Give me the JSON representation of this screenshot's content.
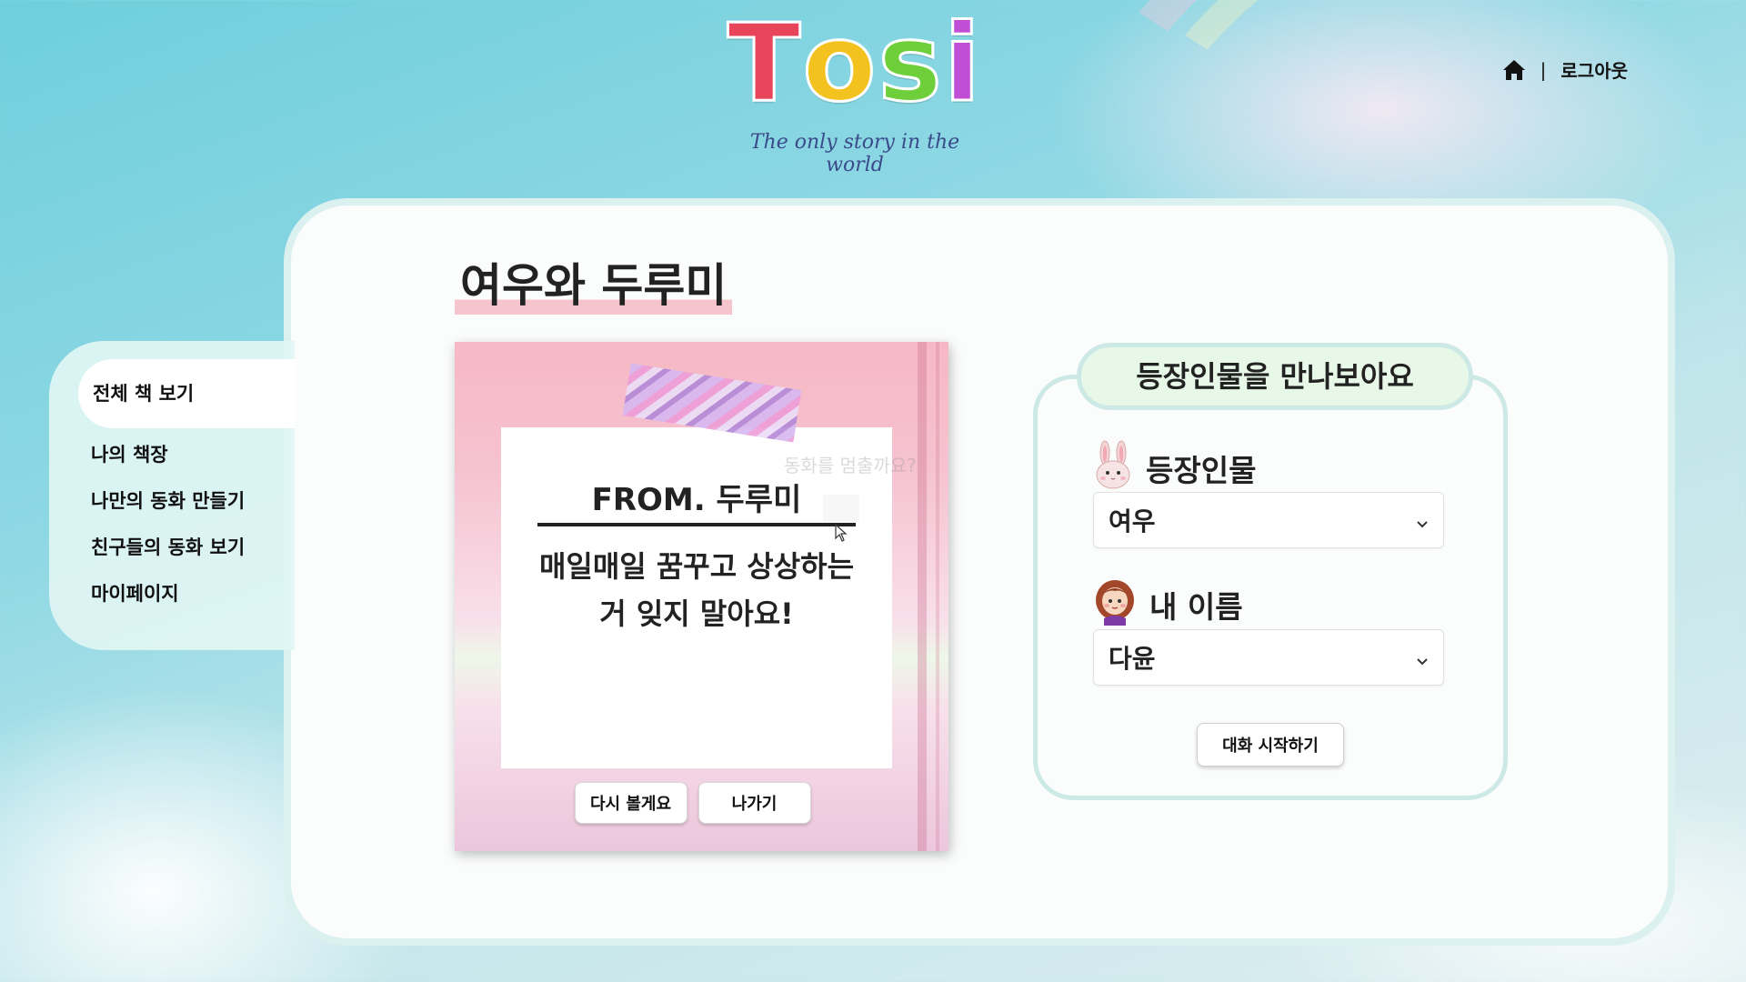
{
  "logo": {
    "letters": [
      "T",
      "o",
      "s",
      "i"
    ],
    "letter_colors": [
      "#e8455a",
      "#f4c21e",
      "#6fcf3a",
      "#c14fd6"
    ],
    "tagline": "The only story in the world"
  },
  "topnav": {
    "home_icon": "home-icon",
    "separator": "|",
    "logout_label": "로그아웃"
  },
  "sidebar": {
    "items": [
      {
        "label": "전체 책 보기",
        "active": true
      },
      {
        "label": "나의 책장",
        "active": false
      },
      {
        "label": "나만의 동화 만들기",
        "active": false
      },
      {
        "label": "친구들의 동화 보기",
        "active": false
      },
      {
        "label": "마이페이지",
        "active": false
      }
    ]
  },
  "book": {
    "title": "여우와 두루미",
    "letter_from": "FROM. 두루미",
    "letter_message": "매일매일 꿈꾸고 상상하는\n거 잊지 말아요!",
    "overlay_text": "동화를 멈출까요?",
    "replay_button": "다시 볼게요",
    "exit_button": "나가기"
  },
  "characters": {
    "heading": "등장인물을 만나보아요",
    "character_label": "등장인물",
    "character_icon": "rabbit-icon",
    "character_value": "여우",
    "myname_label": "내 이름",
    "myname_icon": "girl-avatar-icon",
    "myname_value": "다윤",
    "start_button": "대화 시작하기"
  },
  "colors": {
    "accent_mint": "#cde9e6",
    "heading_bg": "#e7f7e8",
    "title_highlight": "#f5bec8"
  }
}
